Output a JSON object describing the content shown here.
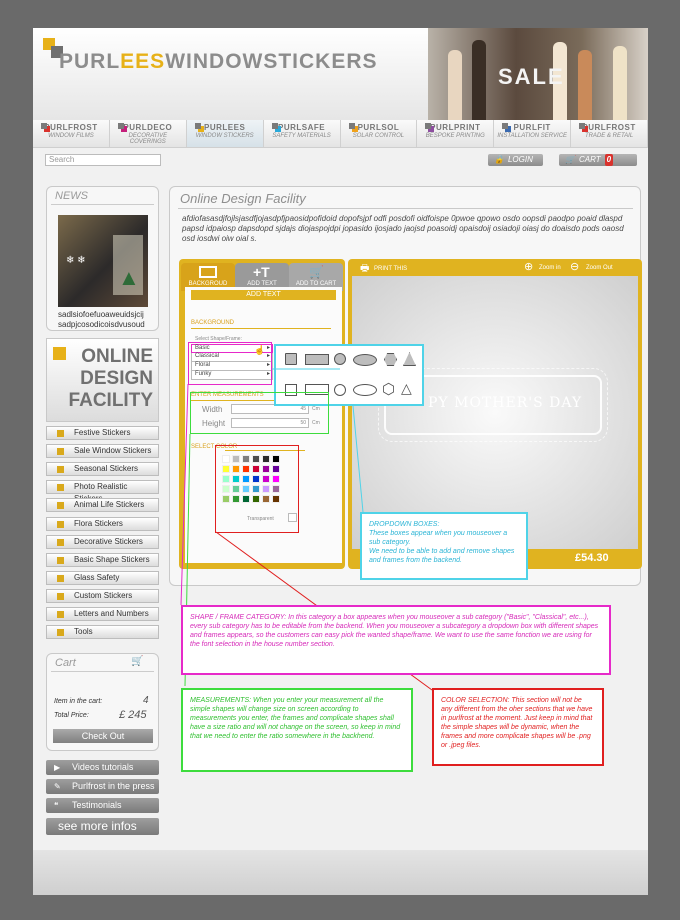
{
  "brand": {
    "name_part1": "PURL",
    "name_part2": "EES",
    "name_part3": "WINDOWSTICKERS",
    "hero_text": "SALE"
  },
  "nav": [
    {
      "name": "PURLFROST",
      "sub": "WINDOW FILMS",
      "color": "#d9322d"
    },
    {
      "name": "PURLDECO",
      "sub": "DECORATIVE COVERINGS",
      "color": "#c51f7b"
    },
    {
      "name": "PURLEES",
      "sub": "WINDOW STICKERS",
      "color": "#e7b118"
    },
    {
      "name": "PURLSAFE",
      "sub": "SAFETY MATERIALS",
      "color": "#2aa9d9"
    },
    {
      "name": "PURLSOL",
      "sub": "SOLAR CONTROL",
      "color": "#f0a21c"
    },
    {
      "name": "PURLPRINT",
      "sub": "BESPOKE PRINTING",
      "color": "#8e4fa0"
    },
    {
      "name": "PURLFIT",
      "sub": "INSTALLATION SERVICE",
      "color": "#3a6ab0"
    },
    {
      "name": "PURLFROST",
      "sub": "TRADE & RETAIL",
      "color": "#d9322d"
    }
  ],
  "search": {
    "placeholder": "Search"
  },
  "login_label": "LOGIN",
  "cart_label": "CART",
  "cart_count": "0",
  "news": {
    "title": "NEWS",
    "line1": "sadlsiofoefuoaweuidsjcij",
    "line2": "sadpjcosodicoisdvusoud"
  },
  "odf_logo": [
    "ONLINE",
    "DESIGN",
    "FACILITY"
  ],
  "menu": [
    "Festive Stickers",
    "Sale Window Stickers",
    "Seasonal Stickers",
    "Photo Realistic Stickers",
    "Animal Life Stickers",
    "Flora Stickers",
    "Decorative Stickers",
    "Basic Shape Stickers",
    "Glass Safety",
    "Custom Stickers",
    "Letters and Numbers",
    "Tools"
  ],
  "cart": {
    "title": "Cart",
    "items_label": "Item in the cart:",
    "items_value": "4",
    "price_label": "Total Price:",
    "price_value": "£ 245",
    "checkout": "Check Out"
  },
  "side_links": [
    "Videos tutorials",
    "Purlfrost in the press",
    "Testimonials",
    "see more infos"
  ],
  "main": {
    "title": "Online Design Facility",
    "lorem": "afdiofasasdjfojlsjasdfjojasdpfjpaosidpofidoid  dopofsjpf odfi posdofi oidfoispe 0pwoe qpowo osdo oopsdi paodpo poaid dlaspd papsd idpaiosp dapsdopd sjdajs diojaspojdpi jopasido ijosjado jaojsd poasoidj opaisdoij osiadoji oiasj do doaisdo pods oaosd osd iosdwi oiw oial s."
  },
  "tools": {
    "tab1": "BACKGROUD",
    "tab2": "ADD TEXT",
    "tab3": "ADD TO CART",
    "add_text": "ADD TEXT",
    "background": "BACKGROUND",
    "select_shape": "Select Shape/Frame:",
    "shape_options": [
      "Basic",
      "Classical",
      "Floral",
      "Funky"
    ],
    "enter_measurements": "ENTER MEASUREMENTS",
    "width_label": "Width",
    "width_value": "45",
    "width_unit": "Cm",
    "height_label": "Height",
    "height_value": "50",
    "height_unit": "Cm",
    "select_color": "SELECT COLOR",
    "transparent": "Transparent"
  },
  "canvas": {
    "print": "PRINT THIS",
    "zoom_in": "Zoom in",
    "zoom_out": "Zoom Out",
    "design_text": "PY MOTHER'S DAY",
    "price": "£54.30"
  },
  "colors": [
    "#ffffff",
    "#bcbcbc",
    "#7e7e7e",
    "#4c4c4c",
    "#2b2b2b",
    "#000000",
    "#ffff33",
    "#ff9a00",
    "#ff3300",
    "#cc0033",
    "#990099",
    "#660099",
    "#99ffcc",
    "#00cccc",
    "#0099ff",
    "#0033cc",
    "#cc00cc",
    "#ff00ff",
    "#ccffcc",
    "#66cc99",
    "#66ccff",
    "#3399cc",
    "#cc99ff",
    "#996699",
    "#99cc66",
    "#339933",
    "#006633",
    "#336600",
    "#996633",
    "#663300"
  ],
  "annotations": {
    "dropdown": "DROPDOWN BOXES:\nThese boxes appear when you mouseover a sub category.\nWe need to be able to add and remove shapes and frames from the backend.",
    "shape_frame": "SHAPE / FRAME CATEGORY: In this category a box appeares when you mouseover a sub category (\"Basic\", \"Classical\", etc...), every sub category has to be editable from the backend. When you mouseover a subcategory a dropdown box with different shapes and frames appears, so the customers can easy pick the wanted shape/frame. We want to use the same fonction we are using for the font selection in the house number section.",
    "measurements": "MEASUREMENTS: When you enter your measurement all the simple shapes will change size on screen according to measurements you enter, the frames and complicate shapes shall have a size ratio and will not change on the screen, so keep in mind that we need to enter the ratio somewhere in the backhend.",
    "color_selection": "COLOR SELECTION: This section will not be any different from the oher sections that we have in purlfrost at the moment. Just keep in mind that the simple shapes will be dynamic, when the frames and more complicate shapes will be .png or .jpeg files."
  }
}
